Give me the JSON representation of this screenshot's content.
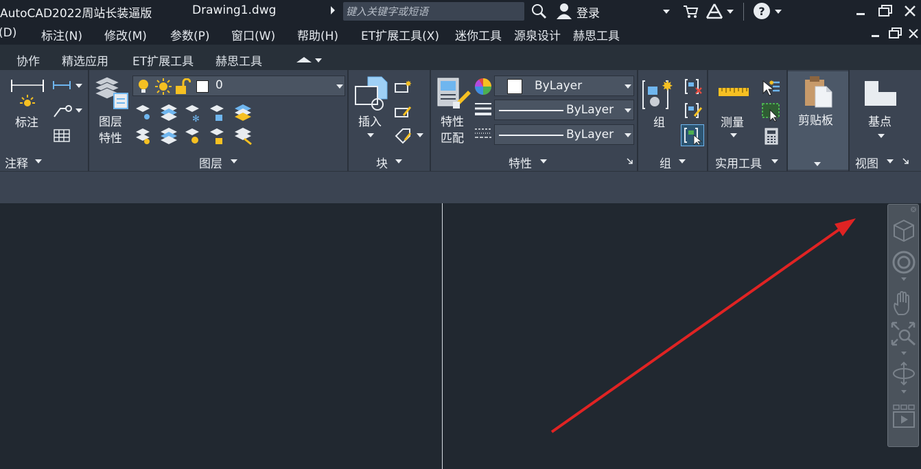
{
  "window": {
    "app_title": "AutoCAD2022周站长装逼版",
    "document": "Drawing1.dwg",
    "search_placeholder": "键入关键字或短语",
    "login": "登录"
  },
  "menu": [
    "(D)",
    "标注(N)",
    "修改(M)",
    "参数(P)",
    "窗口(W)",
    "帮助(H)",
    "ET扩展工具(X)",
    "迷你工具",
    "源泉设计",
    "赫思工具"
  ],
  "tabs": [
    "协作",
    "精选应用",
    "ET扩展工具",
    "赫思工具"
  ],
  "ribbon": {
    "annotation": {
      "dimension_label": "标注",
      "panel_title": "注释"
    },
    "layers": {
      "properties_label_1": "图层",
      "properties_label_2": "特性",
      "current_layer": "0",
      "panel_title": "图层"
    },
    "block": {
      "insert_label": "插入",
      "panel_title": "块"
    },
    "properties": {
      "match_label_1": "特性",
      "match_label_2": "匹配",
      "color": "ByLayer",
      "linetype": "ByLayer",
      "lineweight": "ByLayer",
      "panel_title": "特性"
    },
    "groups": {
      "group_label": "组",
      "panel_title": "组"
    },
    "utilities": {
      "measure_label": "测量",
      "panel_title": "实用工具"
    },
    "clipboard": {
      "label": "剪贴板"
    },
    "view": {
      "basepoint_label": "基点",
      "panel_title": "视图"
    }
  },
  "colors": {
    "title_bg": "#1c222b",
    "ribbon_bg": "#3b4452",
    "canvas_bg": "#212830",
    "annotation_arrow": "#e02323",
    "accent_blue": "#4aa3e8"
  }
}
